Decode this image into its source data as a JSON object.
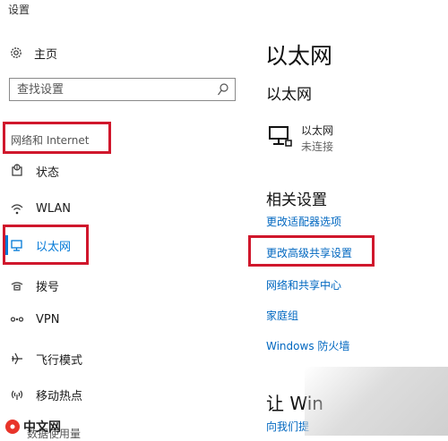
{
  "window": {
    "title": "设置"
  },
  "sidebar": {
    "home_label": "主页",
    "search_placeholder": "查找设置",
    "section_header": "网络和 Internet",
    "items": [
      {
        "label": "状态",
        "icon": "status-globe-icon"
      },
      {
        "label": "WLAN",
        "icon": "wifi-icon"
      },
      {
        "label": "以太网",
        "icon": "ethernet-monitor-icon",
        "active": true
      },
      {
        "label": "拨号",
        "icon": "dialup-icon"
      },
      {
        "label": "VPN",
        "icon": "vpn-icon"
      },
      {
        "label": "飞行模式",
        "icon": "airplane-icon"
      },
      {
        "label": "移动热点",
        "icon": "hotspot-icon"
      }
    ],
    "cut_off_item": "数据使用量"
  },
  "main": {
    "page_title": "以太网",
    "section_title": "以太网",
    "connection": {
      "name": "以太网",
      "status": "未连接",
      "icon": "ethernet-monitor-icon"
    },
    "related": {
      "title": "相关设置",
      "links": [
        "更改适配器选项",
        "更改高级共享设置",
        "网络和共享中心",
        "家庭组",
        "Windows 防火墙"
      ]
    },
    "question_title": "让 Win",
    "help_link": "向我们提"
  },
  "watermark": {
    "text": "中文网"
  },
  "colors": {
    "accent": "#0078d7",
    "link": "#0067c0",
    "highlight_box": "#d0172c"
  }
}
